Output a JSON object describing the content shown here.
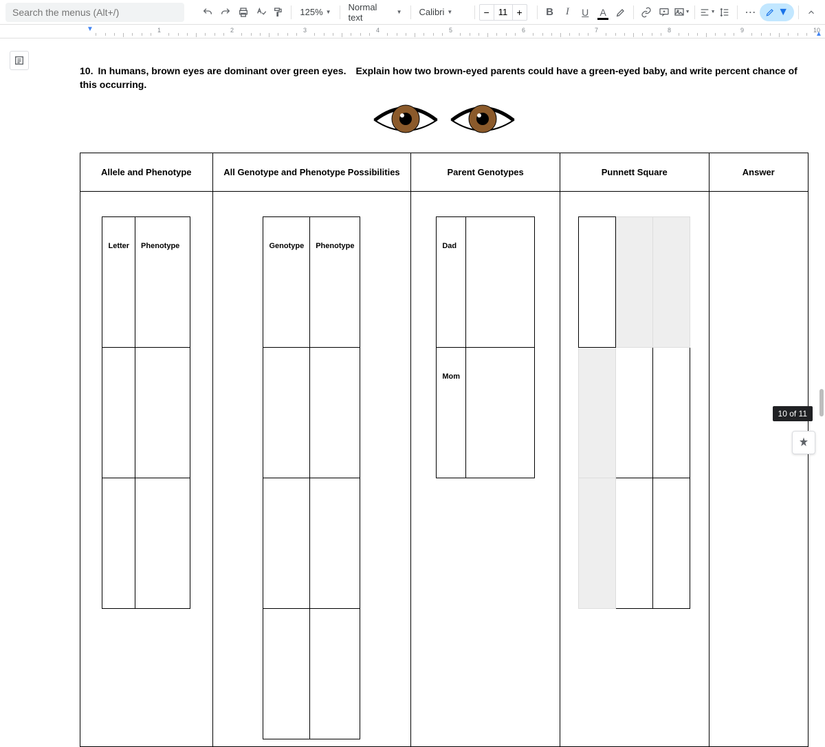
{
  "toolbar": {
    "search_placeholder": "Search the menus (Alt+/)",
    "zoom": "125%",
    "style": "Normal text",
    "font": "Calibri",
    "font_size": "11",
    "bold": "B",
    "italic": "I",
    "underline": "U",
    "text_color": "A"
  },
  "ruler": {
    "marks": [
      "1",
      "2",
      "3",
      "4",
      "5",
      "6",
      "7",
      "8",
      "9",
      "10"
    ]
  },
  "document": {
    "question": "10. In humans, brown eyes are dominant over green eyes. Explain how two brown-eyed parents could have a green-eyed baby, and write percent chance of this occurring.",
    "headers": {
      "allele": "Allele and Phenotype",
      "all_geno": "All Genotype and Phenotype Possibilities",
      "parent": "Parent Genotypes",
      "punnett": "Punnett Square",
      "answer": "Answer"
    },
    "allele_table": {
      "h1": "Letter",
      "h2": "Phenotype"
    },
    "geno_table": {
      "h1": "Genotype",
      "h2": "Phenotype"
    },
    "parent_table": {
      "r1": "Dad",
      "r2": "Mom"
    }
  },
  "status": {
    "page_counter": "10 of 11"
  }
}
